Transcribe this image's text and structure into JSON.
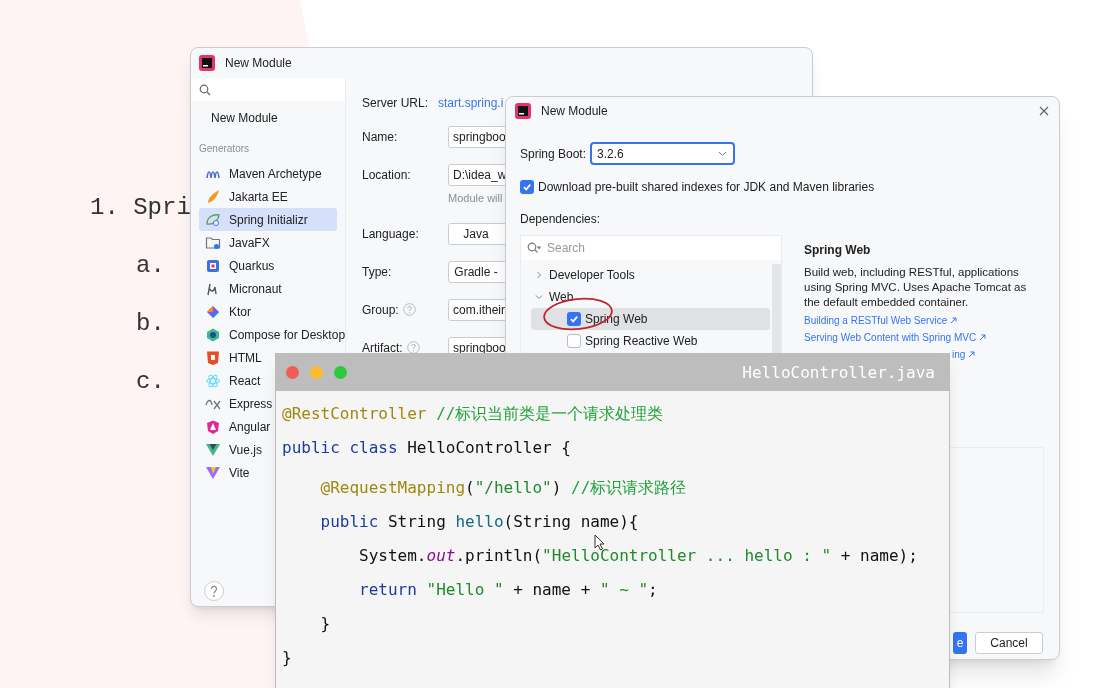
{
  "slide": {
    "heading": "1. Spri",
    "subitems": [
      "a.",
      "b.",
      "c."
    ]
  },
  "module_window": {
    "title": "New Module",
    "top_item": "New Module",
    "section": "Generators",
    "generators": [
      {
        "label": "Maven Archetype",
        "selected": false
      },
      {
        "label": "Jakarta EE",
        "selected": false
      },
      {
        "label": "Spring Initializr",
        "selected": true
      },
      {
        "label": "JavaFX",
        "selected": false
      },
      {
        "label": "Quarkus",
        "selected": false
      },
      {
        "label": "Micronaut",
        "selected": false
      },
      {
        "label": "Ktor",
        "selected": false
      },
      {
        "label": "Compose for Desktop",
        "selected": false
      },
      {
        "label": "HTML",
        "selected": false
      },
      {
        "label": "React",
        "selected": false
      },
      {
        "label": "Express",
        "selected": false
      },
      {
        "label": "Angular",
        "selected": false
      },
      {
        "label": "Vue.js",
        "selected": false
      },
      {
        "label": "Vite",
        "selected": false
      }
    ],
    "server_url": {
      "label": "Server URL:",
      "value": "start.spring.i"
    },
    "form": [
      {
        "label": "Name:",
        "help": false,
        "value": "springboo"
      },
      {
        "label": "Location:",
        "help": false,
        "value": "D:\\idea_w",
        "hint": "Module will"
      },
      {
        "label": "Language:",
        "help": false,
        "value": "Java"
      },
      {
        "label": "Type:",
        "help": false,
        "value": "Gradle -"
      },
      {
        "label": "Group:",
        "help": true,
        "value": "com.itheir"
      },
      {
        "label": "Artifact:",
        "help": true,
        "value": "springboo"
      }
    ]
  },
  "spring_dialog": {
    "title": "New Module",
    "spring_boot": {
      "label": "Spring Boot:",
      "value": "3.2.6"
    },
    "shared_indexes": {
      "label": "Download pre-built shared indexes for JDK and Maven libraries",
      "checked": true
    },
    "dependencies": {
      "label": "Dependencies:",
      "placeholder": "Search",
      "items": [
        {
          "kind": "group",
          "label": "Developer Tools",
          "expanded": false
        },
        {
          "kind": "group",
          "label": "Web",
          "expanded": true
        },
        {
          "kind": "dependency",
          "label": "Spring Web",
          "checked": true,
          "selected": true,
          "circled": true
        },
        {
          "kind": "dependency",
          "label": "Spring Reactive Web",
          "checked": false,
          "selected": false,
          "circled": false
        }
      ]
    },
    "detail": {
      "title": "Spring Web",
      "description": "Build web, including RESTful, applications using Spring MVC. Uses Apache Tomcat as the default embedded container.",
      "links": [
        "Building a RESTful Web Service",
        "Serving Web Content with Spring MVC",
        "ing"
      ]
    },
    "buttons": [
      {
        "label": "e",
        "kind": "primary"
      },
      {
        "label": "Cancel",
        "kind": "secondary"
      }
    ]
  },
  "code_window": {
    "filename": "HelloController.java",
    "lines": [
      {
        "tokens": [
          {
            "kind": "annotation",
            "text": "@RestController"
          },
          {
            "kind": "comment",
            "text": " //标识当前类是一个请求处理类"
          }
        ]
      },
      {
        "tokens": [
          {
            "kind": "keyword",
            "text": "public class"
          },
          {
            "kind": "plain",
            "text": " HelloController {"
          }
        ]
      },
      {
        "kind": "blank"
      },
      {
        "tokens": [
          {
            "kind": "annotation",
            "text": "    @RequestMapping"
          },
          {
            "kind": "plain",
            "text": "("
          },
          {
            "kind": "string",
            "text": "\"/hello\""
          },
          {
            "kind": "plain",
            "text": ") "
          },
          {
            "kind": "comment",
            "text": "//标识请求路径"
          }
        ]
      },
      {
        "tokens": [
          {
            "kind": "keyword",
            "text": "    public"
          },
          {
            "kind": "plain",
            "text": " String "
          },
          {
            "kind": "method",
            "text": "hello"
          },
          {
            "kind": "plain",
            "text": "(String name){"
          }
        ]
      },
      {
        "tokens": [
          {
            "kind": "plain",
            "text": "        System."
          },
          {
            "kind": "static",
            "text": "out"
          },
          {
            "kind": "plain",
            "text": ".println("
          },
          {
            "kind": "string",
            "text": "\"HelloController ... hello : \""
          },
          {
            "kind": "plain",
            "text": " + name);"
          }
        ]
      },
      {
        "tokens": [
          {
            "kind": "keyword",
            "text": "        return"
          },
          {
            "kind": "string",
            "text": " \"Hello \""
          },
          {
            "kind": "plain",
            "text": " + name + "
          },
          {
            "kind": "string",
            "text": "\" ~ \""
          },
          {
            "kind": "plain",
            "text": ";"
          }
        ]
      },
      {
        "tokens": [
          {
            "kind": "plain",
            "text": "    }"
          }
        ]
      },
      {
        "tokens": [
          {
            "kind": "plain",
            "text": "}"
          }
        ]
      }
    ]
  }
}
